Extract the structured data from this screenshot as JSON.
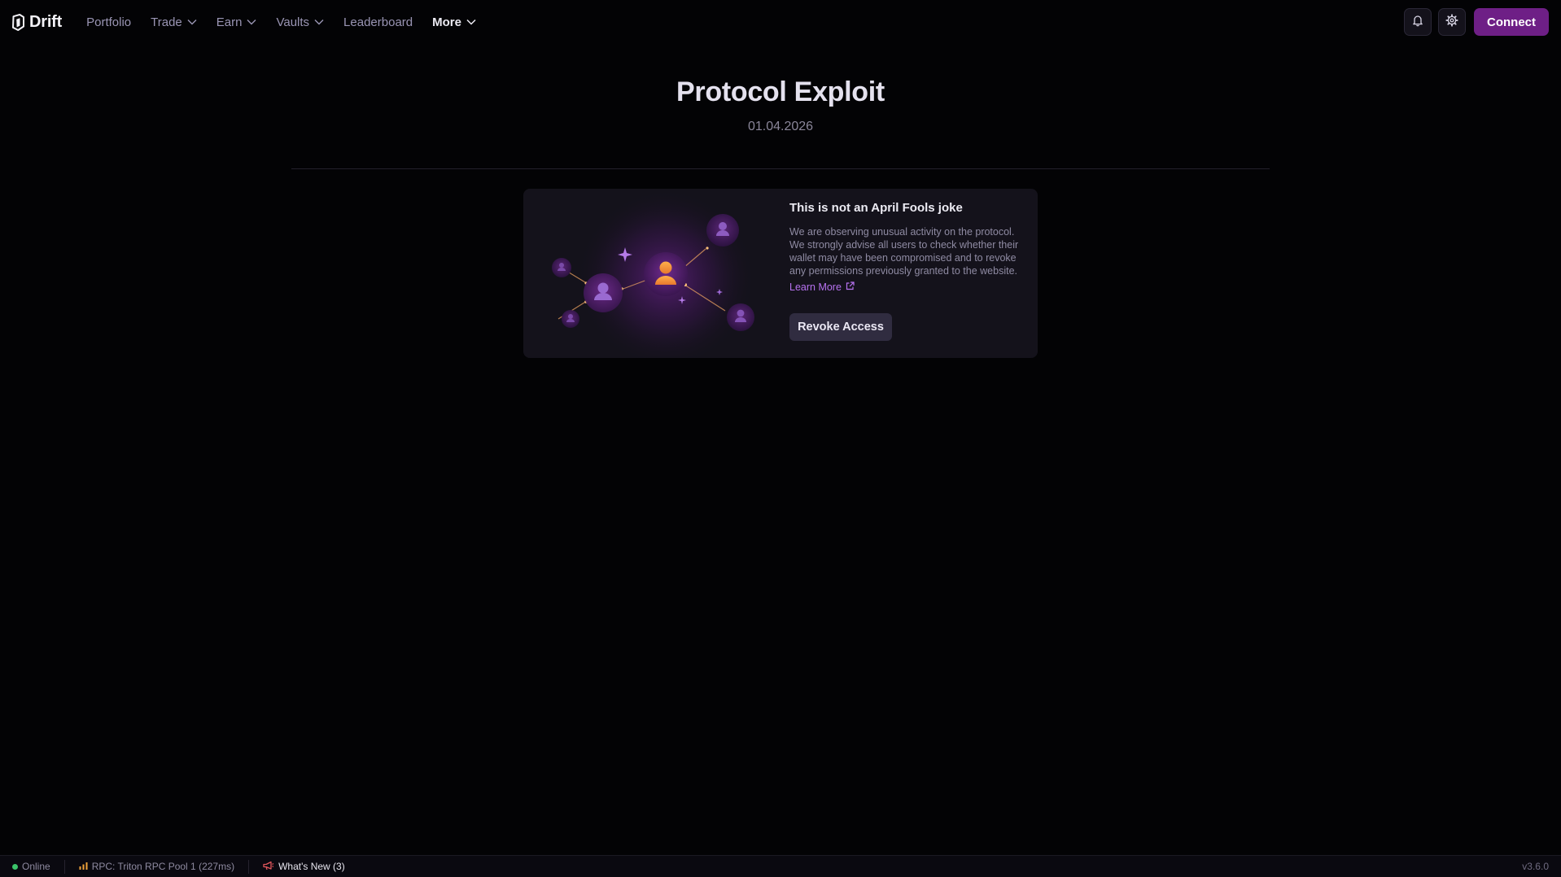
{
  "brand": {
    "name": "Drift",
    "logo_icon": "drift-logo-icon",
    "accent": "#6e1f86",
    "link_color": "#b772f0"
  },
  "nav": {
    "items": [
      {
        "label": "Portfolio",
        "has_dropdown": false
      },
      {
        "label": "Trade",
        "has_dropdown": true
      },
      {
        "label": "Earn",
        "has_dropdown": true
      },
      {
        "label": "Vaults",
        "has_dropdown": true
      },
      {
        "label": "Leaderboard",
        "has_dropdown": false
      },
      {
        "label": "More",
        "has_dropdown": true,
        "active": true
      }
    ],
    "notifications_icon": "bell-icon",
    "settings_icon": "gear-icon",
    "connect_label": "Connect"
  },
  "hero": {
    "title": "Protocol Exploit",
    "date": "01.04.2026"
  },
  "notice": {
    "illustration_icon": "network-people-illustration",
    "title": "This is not an April Fools joke",
    "body": "We are observing unusual activity on the protocol. We strongly advise all users to check whether their wallet may have been compromised and to revoke any permissions previously granted to the website.",
    "learn_more": "Learn More",
    "learn_more_icon": "external-link-icon",
    "revoke_label": "Revoke Access"
  },
  "footer": {
    "status": "Online",
    "status_color": "#3bc46a",
    "rpc": "RPC: Triton RPC Pool 1 (227ms)",
    "rpc_icon": "signal-bars-icon",
    "whats_new": "What's New (3)",
    "whats_new_icon": "megaphone-icon",
    "version": "v3.6.0"
  }
}
